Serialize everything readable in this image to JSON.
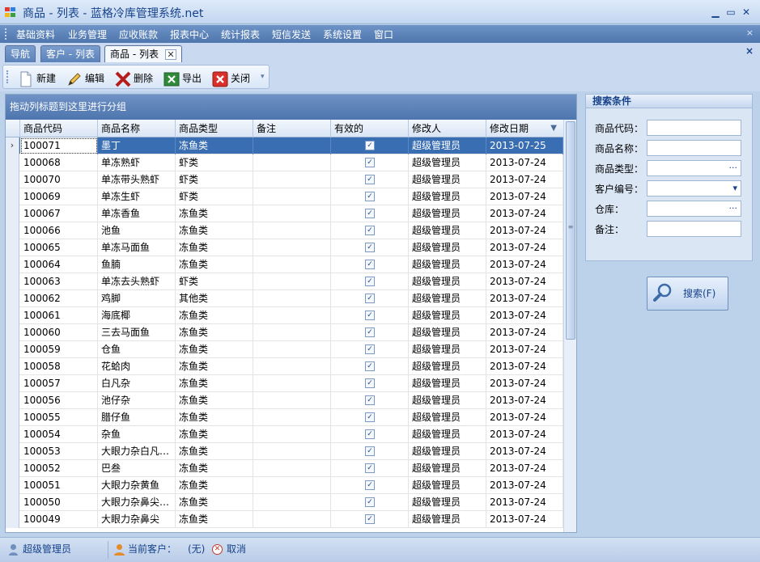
{
  "window": {
    "title": "商品 - 列表 - 蓝格冷库管理系统.net",
    "min": "▁",
    "max": "▭",
    "close": "✕"
  },
  "menu": [
    "基础资料",
    "业务管理",
    "应收账款",
    "报表中心",
    "统计报表",
    "短信发送",
    "系统设置",
    "窗口"
  ],
  "menu_close": "×",
  "tabs": [
    {
      "label": "导航"
    },
    {
      "label": "客户 - 列表"
    },
    {
      "label": "商品 - 列表"
    }
  ],
  "tab_close": "✕",
  "tabs_close_all": "×",
  "toolbar": {
    "new": "新建",
    "edit": "编辑",
    "delete": "删除",
    "export": "导出",
    "close": "关闭"
  },
  "grid": {
    "group_hint": "拖动列标题到这里进行分组",
    "columns": [
      "商品代码",
      "商品名称",
      "商品类型",
      "备注",
      "有效的",
      "修改人",
      "修改日期"
    ],
    "sort_indicator": "▼",
    "row_indicator": "›",
    "check_glyph": "✓",
    "rows": [
      {
        "code": "100071",
        "name": "墨丁",
        "type": "冻鱼类",
        "note": "",
        "valid": true,
        "modifier": "超级管理员",
        "date": "2013-07-25"
      },
      {
        "code": "100068",
        "name": "单冻熟虾",
        "type": "虾类",
        "note": "",
        "valid": true,
        "modifier": "超级管理员",
        "date": "2013-07-24"
      },
      {
        "code": "100070",
        "name": "单冻带头熟虾",
        "type": "虾类",
        "note": "",
        "valid": true,
        "modifier": "超级管理员",
        "date": "2013-07-24"
      },
      {
        "code": "100069",
        "name": "单冻生虾",
        "type": "虾类",
        "note": "",
        "valid": true,
        "modifier": "超级管理员",
        "date": "2013-07-24"
      },
      {
        "code": "100067",
        "name": "单冻香鱼",
        "type": "冻鱼类",
        "note": "",
        "valid": true,
        "modifier": "超级管理员",
        "date": "2013-07-24"
      },
      {
        "code": "100066",
        "name": "池鱼",
        "type": "冻鱼类",
        "note": "",
        "valid": true,
        "modifier": "超级管理员",
        "date": "2013-07-24"
      },
      {
        "code": "100065",
        "name": "单冻马面鱼",
        "type": "冻鱼类",
        "note": "",
        "valid": true,
        "modifier": "超级管理员",
        "date": "2013-07-24"
      },
      {
        "code": "100064",
        "name": "鱼腩",
        "type": "冻鱼类",
        "note": "",
        "valid": true,
        "modifier": "超级管理员",
        "date": "2013-07-24"
      },
      {
        "code": "100063",
        "name": "单冻去头熟虾",
        "type": "虾类",
        "note": "",
        "valid": true,
        "modifier": "超级管理员",
        "date": "2013-07-24"
      },
      {
        "code": "100062",
        "name": "鸡脚",
        "type": "其他类",
        "note": "",
        "valid": true,
        "modifier": "超级管理员",
        "date": "2013-07-24"
      },
      {
        "code": "100061",
        "name": "海底椰",
        "type": "冻鱼类",
        "note": "",
        "valid": true,
        "modifier": "超级管理员",
        "date": "2013-07-24"
      },
      {
        "code": "100060",
        "name": "三去马面鱼",
        "type": "冻鱼类",
        "note": "",
        "valid": true,
        "modifier": "超级管理员",
        "date": "2013-07-24"
      },
      {
        "code": "100059",
        "name": "仓鱼",
        "type": "冻鱼类",
        "note": "",
        "valid": true,
        "modifier": "超级管理员",
        "date": "2013-07-24"
      },
      {
        "code": "100058",
        "name": "花蛤肉",
        "type": "冻鱼类",
        "note": "",
        "valid": true,
        "modifier": "超级管理员",
        "date": "2013-07-24"
      },
      {
        "code": "100057",
        "name": "白凡杂",
        "type": "冻鱼类",
        "note": "",
        "valid": true,
        "modifier": "超级管理员",
        "date": "2013-07-24"
      },
      {
        "code": "100056",
        "name": "池仔杂",
        "type": "冻鱼类",
        "note": "",
        "valid": true,
        "modifier": "超级管理员",
        "date": "2013-07-24"
      },
      {
        "code": "100055",
        "name": "腊仔鱼",
        "type": "冻鱼类",
        "note": "",
        "valid": true,
        "modifier": "超级管理员",
        "date": "2013-07-24"
      },
      {
        "code": "100054",
        "name": "杂鱼",
        "type": "冻鱼类",
        "note": "",
        "valid": true,
        "modifier": "超级管理员",
        "date": "2013-07-24"
      },
      {
        "code": "100053",
        "name": "大眼力杂白凡…",
        "type": "冻鱼类",
        "note": "",
        "valid": true,
        "modifier": "超级管理员",
        "date": "2013-07-24"
      },
      {
        "code": "100052",
        "name": "巴叁",
        "type": "冻鱼类",
        "note": "",
        "valid": true,
        "modifier": "超级管理员",
        "date": "2013-07-24"
      },
      {
        "code": "100051",
        "name": "大眼力杂黄鱼",
        "type": "冻鱼类",
        "note": "",
        "valid": true,
        "modifier": "超级管理员",
        "date": "2013-07-24"
      },
      {
        "code": "100050",
        "name": "大眼力杂鼻尖…",
        "type": "冻鱼类",
        "note": "",
        "valid": true,
        "modifier": "超级管理员",
        "date": "2013-07-24"
      },
      {
        "code": "100049",
        "name": "大眼力杂鼻尖",
        "type": "冻鱼类",
        "note": "",
        "valid": true,
        "modifier": "超级管理员",
        "date": "2013-07-24"
      }
    ]
  },
  "search_panel": {
    "title": "搜索条件",
    "fields": [
      {
        "label": "商品代码：",
        "value": "",
        "button": ""
      },
      {
        "label": "商品名称：",
        "value": "",
        "button": ""
      },
      {
        "label": "商品类型：",
        "value": "",
        "button": "···"
      },
      {
        "label": "客户编号：",
        "value": "",
        "button": "▾"
      },
      {
        "label": "仓库：",
        "value": "",
        "button": "···"
      },
      {
        "label": "备注：",
        "value": "",
        "button": ""
      }
    ],
    "search_button": "搜索(F)"
  },
  "status": {
    "user": "超级管理员",
    "current_customer_label": "当前客户：",
    "current_customer_value": "(无)",
    "cancel": "取消"
  }
}
